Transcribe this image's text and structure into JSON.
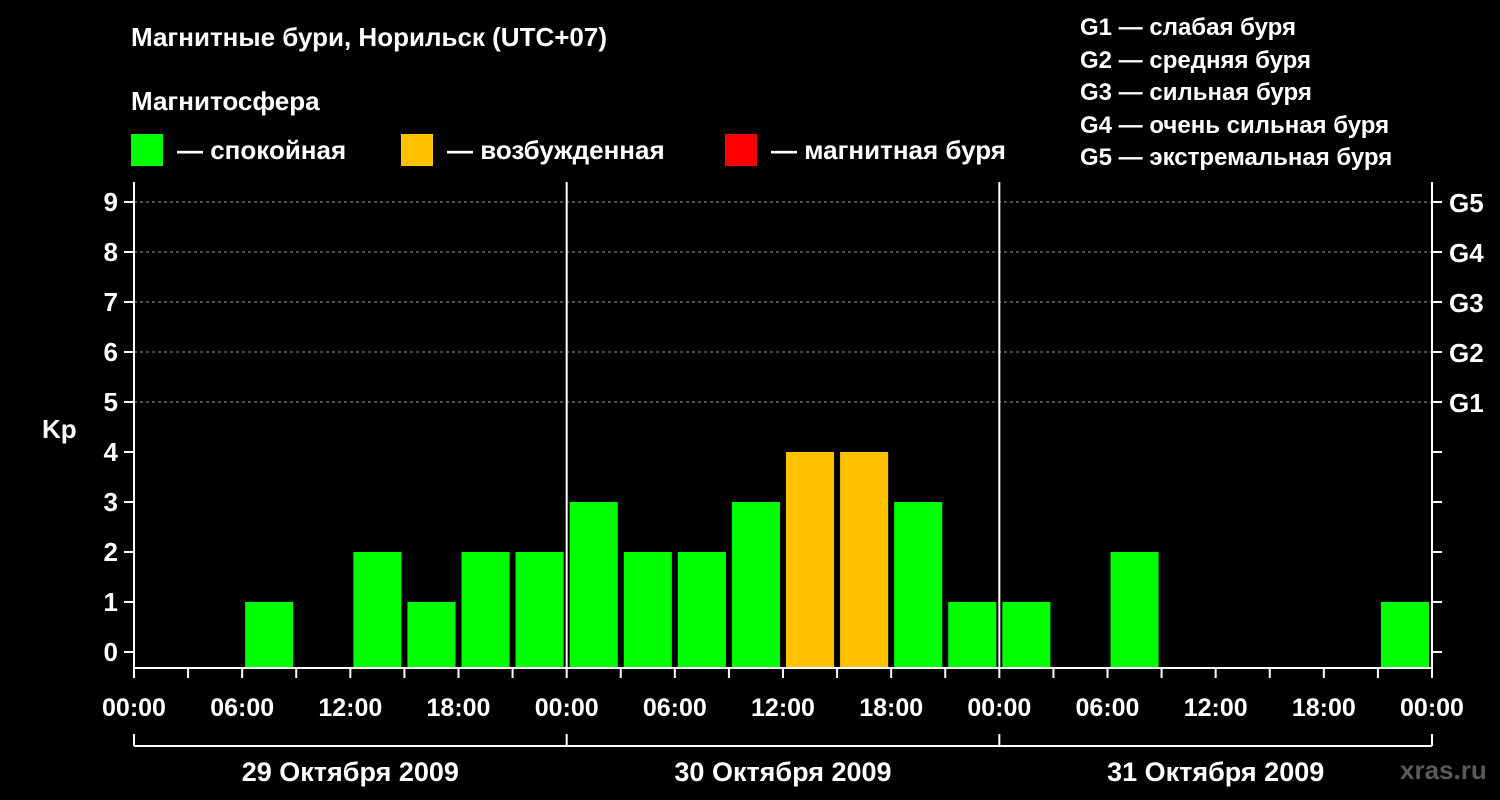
{
  "title": "Магнитные бури, Норильск (UTC+07)",
  "subtitle": "Магнитосфера",
  "legend": [
    {
      "label": "— спокойная",
      "color": "#00ff00"
    },
    {
      "label": "— возбужденная",
      "color": "#ffc000"
    },
    {
      "label": "— магнитная буря",
      "color": "#ff0000"
    }
  ],
  "g_scale": [
    "G1 — слабая буря",
    "G2 — средняя буря",
    "G3 — сильная буря",
    "G4 — очень сильная буря",
    "G5 — экстремальная буря"
  ],
  "watermark": "xras.ru",
  "colors": {
    "calm": "#00ff00",
    "excited": "#ffc000",
    "storm": "#ff0000",
    "axis": "#ffffff",
    "grid": "#999999"
  },
  "chart_data": {
    "type": "bar",
    "ylabel": "Kp",
    "ylim": [
      0,
      9
    ],
    "yticks": [
      0,
      1,
      2,
      3,
      4,
      5,
      6,
      7,
      8,
      9
    ],
    "right_ticks": [
      {
        "value": 5,
        "label": "G1"
      },
      {
        "value": 6,
        "label": "G2"
      },
      {
        "value": 7,
        "label": "G3"
      },
      {
        "value": 8,
        "label": "G4"
      },
      {
        "value": 9,
        "label": "G5"
      }
    ],
    "grid": "dashed horizontal at Kp 5–9",
    "xtick_labels": [
      "00:00",
      "06:00",
      "12:00",
      "18:00",
      "00:00",
      "06:00",
      "12:00",
      "18:00",
      "00:00",
      "06:00",
      "12:00",
      "18:00",
      "00:00"
    ],
    "days": [
      "29 Октября 2009",
      "30 Октября 2009",
      "31 Октября 2009"
    ],
    "bar_interval_hours": 3,
    "series": [
      {
        "values": [
          0,
          0,
          1,
          0,
          2,
          1,
          2,
          2,
          3,
          2,
          2,
          3,
          4,
          4,
          3,
          1,
          1,
          0,
          2,
          0,
          0,
          0,
          0,
          1
        ]
      }
    ]
  }
}
